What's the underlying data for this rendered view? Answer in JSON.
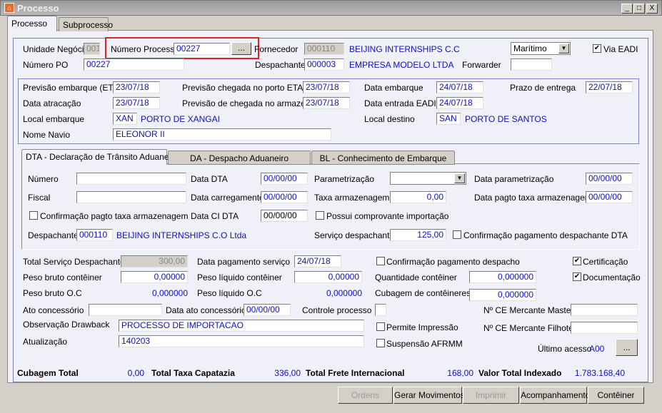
{
  "window": {
    "title": "Processo",
    "minimize": "_",
    "maximize": "□",
    "close": "X"
  },
  "tabs": [
    "Processo",
    "Subprocesso"
  ],
  "header": {
    "unidade_label": "Unidade Negócio",
    "unidade": "001",
    "numproc_label": "Número Processo",
    "numproc": "00227",
    "lookup": "...",
    "fornecedor_label": "Fornecedor",
    "fornecedor_code": "000110",
    "fornecedor_name": "BEIJING INTERNSHIPS C.C",
    "modal": "Marítimo",
    "via_eadi_label": "Via EADI",
    "via_eadi": true,
    "po_label": "Número PO",
    "po": "00227",
    "despachante_label": "Despachante",
    "despachante_code": "000003",
    "despachante_name": "EMPRESA MODELO LTDA",
    "forwarder_label": "Forwarder",
    "forwarder": ""
  },
  "dates": {
    "etd_label": "Previsão embarque (ETD)",
    "etd": "23/07/18",
    "eta_label": "Previsão chegada no porto ETA",
    "eta": "23/07/18",
    "embarque_label": "Data embarque",
    "embarque": "24/07/18",
    "prazo_label": "Prazo de entrega",
    "prazo": "22/07/18",
    "atracacao_label": "Data atracação",
    "atracacao": "23/07/18",
    "armazem_label": "Previsão de chegada no armazém",
    "armazem": "23/07/18",
    "entrada_label": "Data entrada EADI",
    "entrada": "24/07/18",
    "local_emb_label": "Local embarque",
    "local_emb_code": "XAN",
    "local_emb_name": "PORTO DE XANGAI",
    "local_dest_label": "Local destino",
    "local_dest_code": "SAN",
    "local_dest_name": "PORTO DE SANTOS",
    "navio_label": "Nome Navio",
    "navio": "ELEONOR II"
  },
  "subtabs": [
    "DTA - Declaração de Trânsito Aduaneiro",
    "DA - Despacho Aduaneiro",
    "BL - Conhecimento de Embarque"
  ],
  "dta": {
    "numero_label": "Número",
    "numero": "",
    "data_dta_label": "Data DTA",
    "data_dta": "00/00/00",
    "param_label": "Parametrização",
    "param": "",
    "data_param_label": "Data parametrização",
    "data_param": "00/00/00",
    "fiscal_label": "Fiscal",
    "fiscal": "",
    "carreg_label": "Data carregamento",
    "carreg": "00/00/00",
    "taxa_label": "Taxa armazenagem",
    "taxa": "0,00",
    "pagto_taxa_label": "Data pagto taxa armazenagem",
    "pagto_taxa": "00/00/00",
    "conf_taxa_label": "Confirmação pagto taxa armazenagem",
    "ci_label": "Data CI DTA",
    "ci": "00/00/00",
    "comprov_label": "Possui comprovante importação",
    "desp_label": "Despachante",
    "desp_code": "000110",
    "desp_name": "BEIJING INTERNSHIPS C.O Ltda",
    "serv_label": "Serviço despachante",
    "serv": "125,00",
    "conf_desp_label": "Confirmação pagamento despachante DTA"
  },
  "lower": {
    "total_serv_label": "Total Serviço Despachante",
    "total_serv": "300,00",
    "data_pag_label": "Data pagamento serviço",
    "data_pag": "24/07/18",
    "conf_pag_label": "Confirmação pagamento despacho",
    "cert_label": "Certificação",
    "doc_label": "Documentação",
    "pb_cont_label": "Peso bruto contêiner",
    "pb_cont": "0,00000",
    "pl_cont_label": "Peso líquido contêiner",
    "pl_cont": "0,00000",
    "qtd_label": "Quantidade contêiner",
    "qtd": "0,000000",
    "pb_oc_label": "Peso bruto O.C",
    "pb_oc": "0,000000",
    "pl_oc_label": "Peso líquido O.C",
    "pl_oc": "0,000000",
    "cub_label": "Cubagem de contêineres",
    "cub": "0,000000",
    "ato_label": "Ato concessório",
    "ato": "",
    "data_ato_label": "Data ato concessório",
    "data_ato": "00/00/00",
    "controle_label": "Controle processo",
    "controle": "",
    "ce_master_label": "Nº CE Mercante Master",
    "ce_master": "",
    "obs_label": "Observação Drawback",
    "obs": "PROCESSO DE IMPORTACAO",
    "permite_label": "Permite Impressão",
    "ce_filhote_label": "Nº CE Mercante Filhote",
    "ce_filhote": "",
    "atual_label": "Atualização",
    "atual": "140203",
    "afrmm_label": "Suspensão AFRMM",
    "ultimo_label": "Último acesso",
    "ultimo": "A00",
    "ultimo_btn": "..."
  },
  "totals": {
    "cub_label": "Cubagem Total",
    "cub": "0,00",
    "capatazia_label": "Total Taxa Capatazia",
    "capatazia": "336,00",
    "frete_label": "Total Frete Internacional",
    "frete": "168,00",
    "indexado_label": "Valor Total Indexado",
    "indexado": "1.783.168,40"
  },
  "buttons": [
    "Ordens",
    "Gerar Movimentos",
    "Imprimir",
    "Acompanhamento",
    "Contêiner"
  ]
}
